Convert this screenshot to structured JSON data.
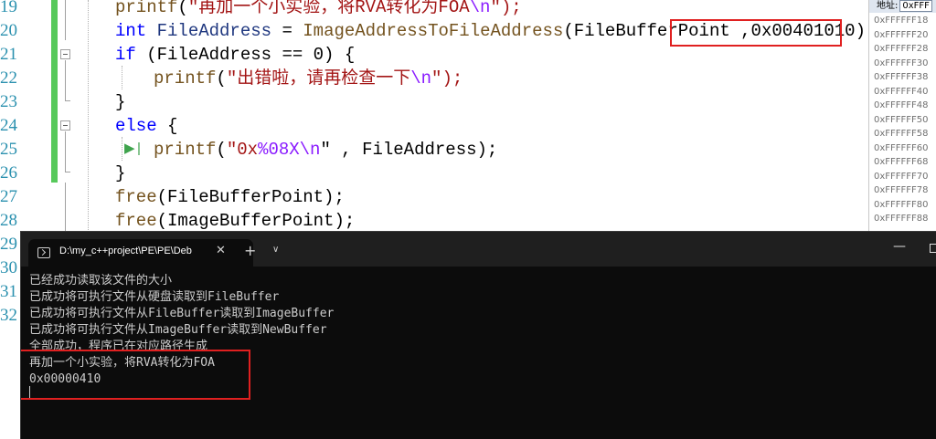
{
  "editor": {
    "line_numbers": [
      "19",
      "20",
      "21",
      "22",
      "23",
      "24",
      "25",
      "26",
      "27",
      "28",
      "29",
      "30",
      "31",
      "32"
    ],
    "code": {
      "l19": {
        "fn": "printf",
        "open": "(",
        "str": "\"再加一个小实验，将RVA转化为FOA",
        "esc": "\\n",
        "close": "\");"
      },
      "l20": {
        "kw": "int",
        "var": " FileAddress",
        "mid": " = ",
        "fn": "ImageAddressToFileAddress",
        "args": "(FileBufferPoint ,0x00401010);"
      },
      "l21": {
        "kw": "if",
        "rest": " (FileAddress == 0) {"
      },
      "l22": {
        "fn": "printf",
        "open": "(",
        "str": "\"出错啦，请再检查一下",
        "esc": "\\n",
        "close": "\");"
      },
      "l23": {
        "text": "}"
      },
      "l24": {
        "kw": "else",
        "rest": " {"
      },
      "l25": {
        "marker": "▶|",
        "fn": "printf",
        "open": "(",
        "str": "\"0x",
        "fmt": "%08X",
        "esc": "\\n",
        "close": "\" , FileAddress);"
      },
      "l26": {
        "text": "}"
      },
      "l27": {
        "fn": "free",
        "rest": "(FileBufferPoint);"
      },
      "l28": {
        "fn": "free",
        "rest": "(ImageBufferPoint);"
      }
    }
  },
  "memory": {
    "label": "地址:",
    "address_value": "0xFFF",
    "rows": [
      "0xFFFFFF18",
      "0xFFFFFF20",
      "0xFFFFFF28",
      "0xFFFFFF30",
      "0xFFFFFF38",
      "0xFFFFFF40",
      "0xFFFFFF48",
      "0xFFFFFF50",
      "0xFFFFFF58",
      "0xFFFFFF60",
      "0xFFFFFF68",
      "0xFFFFFF70",
      "0xFFFFFF78",
      "0xFFFFFF80",
      "0xFFFFFF88"
    ]
  },
  "terminal": {
    "tab_title": "D:\\my_c++project\\PE\\PE\\Deb",
    "close_glyph": "✕",
    "add_glyph": "+",
    "dropdown_glyph": "∨",
    "minimize_glyph": "—",
    "output": [
      "已经成功读取该文件的大小",
      "已成功将可执行文件从硬盘读取到FileBuffer",
      "已成功将可执行文件从FileBuffer读取到ImageBuffer",
      "已成功将可执行文件从ImageBuffer读取到NewBuffer",
      "全部成功，程序已在对应路径生成",
      "再加一个小实验，将RVA转化为FOA",
      "0x00000410"
    ]
  },
  "colors": {
    "highlight_box": "#e02020",
    "change_bar": "#57c95b",
    "line_number": "#2b91af",
    "keyword": "#0000ff",
    "string": "#a31515"
  }
}
